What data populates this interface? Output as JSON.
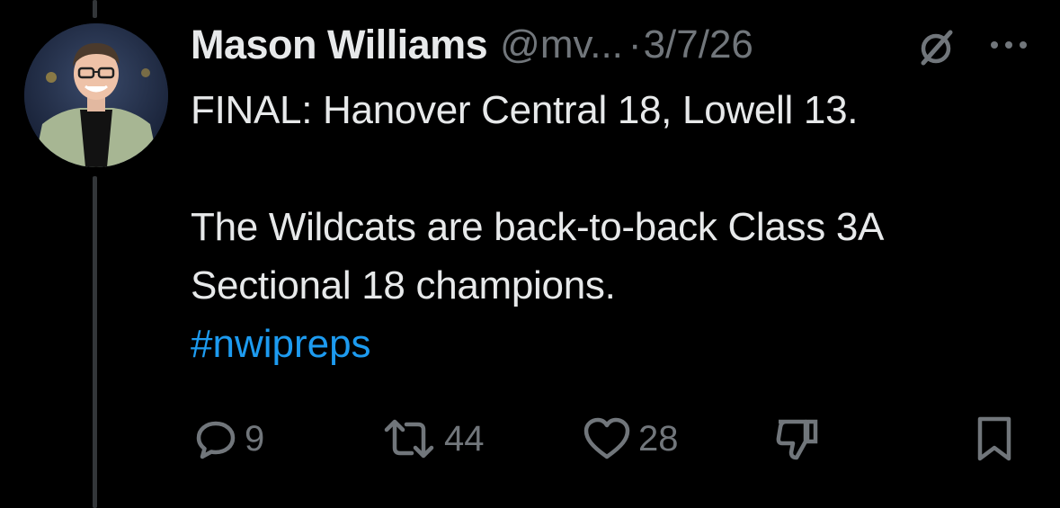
{
  "author": {
    "display_name": "Mason Williams",
    "handle": "@mv...",
    "separator": "·",
    "date": "3/7/26"
  },
  "tweet": {
    "text": "FINAL: Hanover Central 18, Lowell 13.\n\nThe Wildcats are back-to-back Class 3A Sectional 18 champions.",
    "hashtag": "#nwipreps"
  },
  "actions": {
    "replies": "9",
    "reposts": "44",
    "likes": "28"
  },
  "icons": {
    "mute": "mute-icon",
    "more": "more-icon",
    "reply": "reply-icon",
    "repost": "repost-icon",
    "like": "heart-icon",
    "dislike": "thumbs-down-icon",
    "bookmark": "bookmark-icon"
  },
  "colors": {
    "background": "#000000",
    "text": "#e7e9ea",
    "muted": "#71767b",
    "link": "#1d9bf0",
    "thread_line": "#333639"
  }
}
